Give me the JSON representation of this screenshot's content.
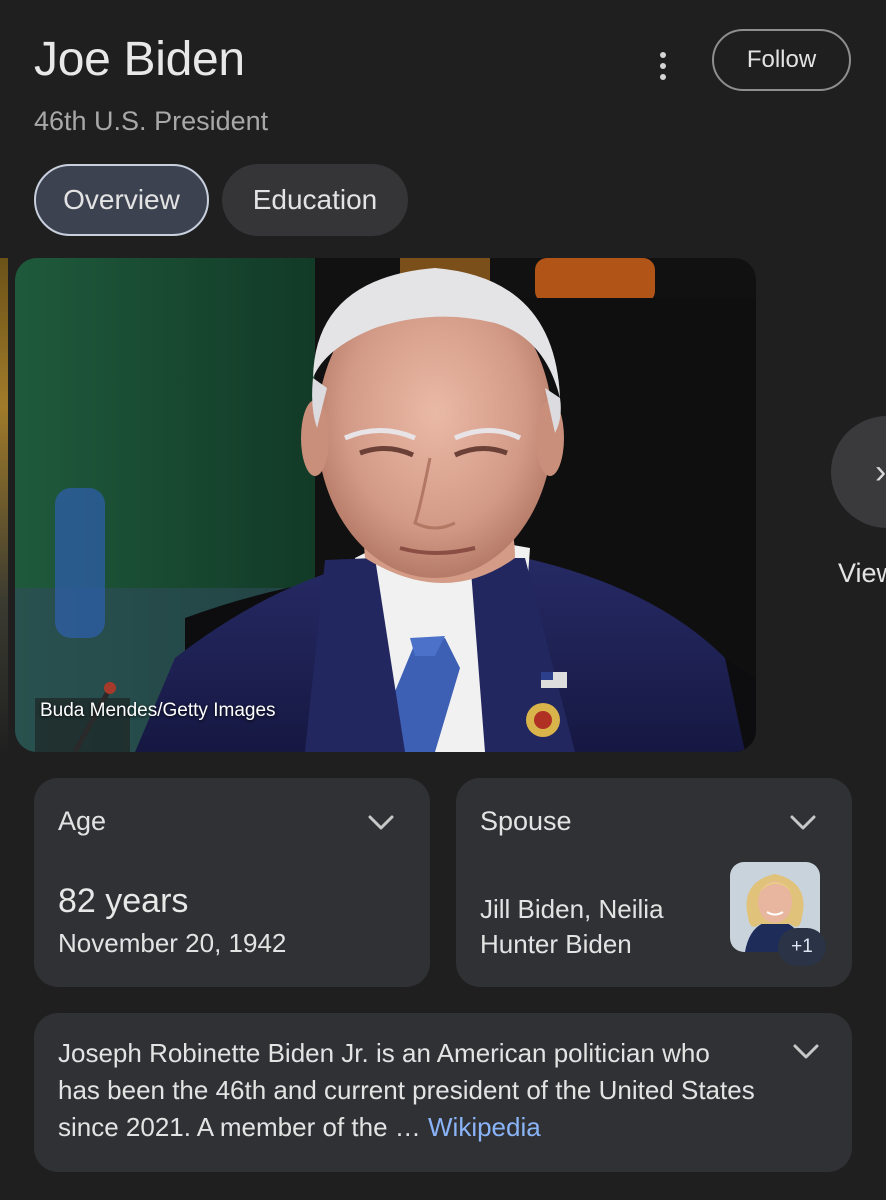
{
  "header": {
    "title": "Joe Biden",
    "subtitle": "46th U.S. President",
    "follow_label": "Follow",
    "more_icon": "more-vert-icon"
  },
  "tabs": [
    {
      "label": "Overview",
      "active": true
    },
    {
      "label": "Education",
      "active": false
    }
  ],
  "image": {
    "credit": "Buda Mendes/Getty Images",
    "view_label": "View",
    "next_icon": "chevron-right-icon"
  },
  "age_card": {
    "label": "Age",
    "value": "82 years",
    "date": "November 20, 1942"
  },
  "spouse_card": {
    "label": "Spouse",
    "names": "Jill Biden, Neilia Hunter Biden",
    "more_count": "+1"
  },
  "description": {
    "text": "Joseph Robinette Biden Jr. is an American politician who has been the 46th and current president of the United States since 2021. A member of the",
    "ellipsis": " … ",
    "link": "Wikipedia"
  },
  "colors": {
    "background": "#1f1f1f",
    "card": "#303134",
    "link": "#8ab4f8",
    "active_tab": "#3c4250"
  }
}
